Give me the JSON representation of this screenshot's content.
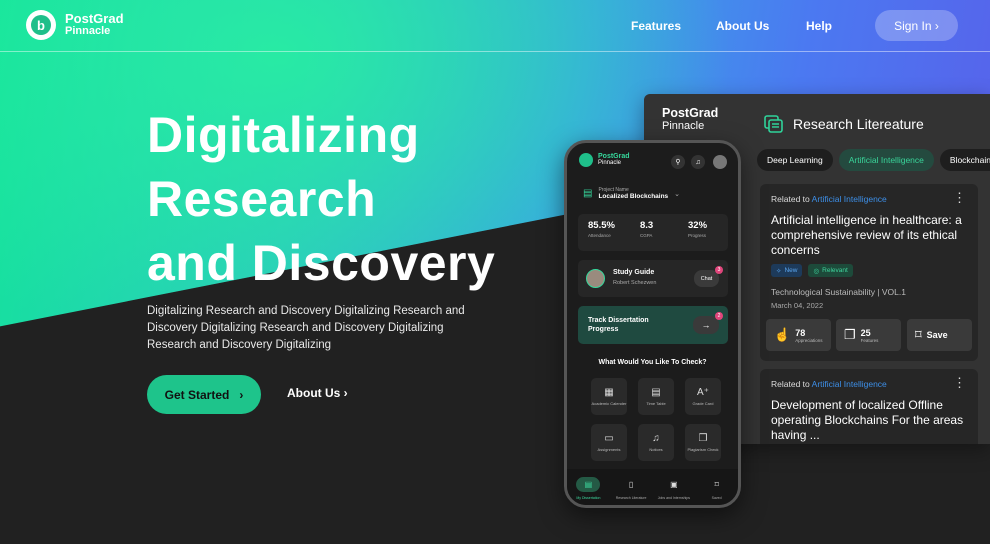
{
  "brand": {
    "name": "PostGrad",
    "sub": "Pinnacle"
  },
  "nav": {
    "features": "Features",
    "about": "About Us",
    "help": "Help",
    "signin": "Sign In ›"
  },
  "hero": {
    "l1": "Digitalizing",
    "l2": "Research",
    "l3": "and Discovery",
    "sub": "Digitalizing Research and Discovery Digitalizing Research and Discovery Digitalizing Research and Discovery Digitalizing Research and Discovery Digitalizing",
    "cta": "Get Started",
    "cta_arrow": "›",
    "about": "About Us ›"
  },
  "panel": {
    "brand": "PostGrad",
    "sub": "Pinnacle",
    "title": "Research Litereature",
    "chips": [
      "Deep Learning",
      "Artificial Intelligence",
      "Blockchain"
    ],
    "card1": {
      "rel": "Related to",
      "topic": "Artificial Intelligence",
      "title": "Artificial intelligence in healthcare: a comprehensive review of its ethical concerns",
      "tag_new": "New",
      "tag_rel": "Relevant",
      "source": "Technological Sustainability | VOL.1",
      "date": "March 04, 2022",
      "appr": "78",
      "appr_l": "Appreciations",
      "feat": "25",
      "feat_l": "Features",
      "save": "Save"
    },
    "card2": {
      "rel": "Related to",
      "topic": "Artificial Intelligence",
      "title": "Development of localized Offline operating Blockchains For the areas having ..."
    }
  },
  "phone": {
    "brand": "PostGrad",
    "sub": "Pinnacle",
    "proj_label": "Project Name",
    "proj": "Localized Blockchains",
    "stats": [
      {
        "n": "85.5%",
        "l": "Attendance"
      },
      {
        "n": "8.3",
        "l": "CGPA"
      },
      {
        "n": "32%",
        "l": "Progress"
      }
    ],
    "study": {
      "title": "Study Guide",
      "name": "Robert Schezwen",
      "chat": "Chat",
      "badge": "3"
    },
    "track": {
      "l1": "Track  Dissertation",
      "l2": "Progress",
      "badge": "2"
    },
    "question": "What Would You Like To Check?",
    "grid": [
      {
        "l": "Academic Calender",
        "i": "▦"
      },
      {
        "l": "Time Table",
        "i": "▤"
      },
      {
        "l": "Grade Card",
        "i": "A⁺"
      },
      {
        "l": "Assignments",
        "i": "▭"
      },
      {
        "l": "Notices",
        "i": "♫"
      },
      {
        "l": "Plagiarism Check",
        "i": "❐"
      }
    ],
    "tabs": [
      {
        "l": "My Dissertation",
        "i": "▤"
      },
      {
        "l": "Research Literature",
        "i": "▯"
      },
      {
        "l": "Jobs and Internships",
        "i": "▣"
      },
      {
        "l": "Saved",
        "i": "⌑"
      }
    ]
  }
}
